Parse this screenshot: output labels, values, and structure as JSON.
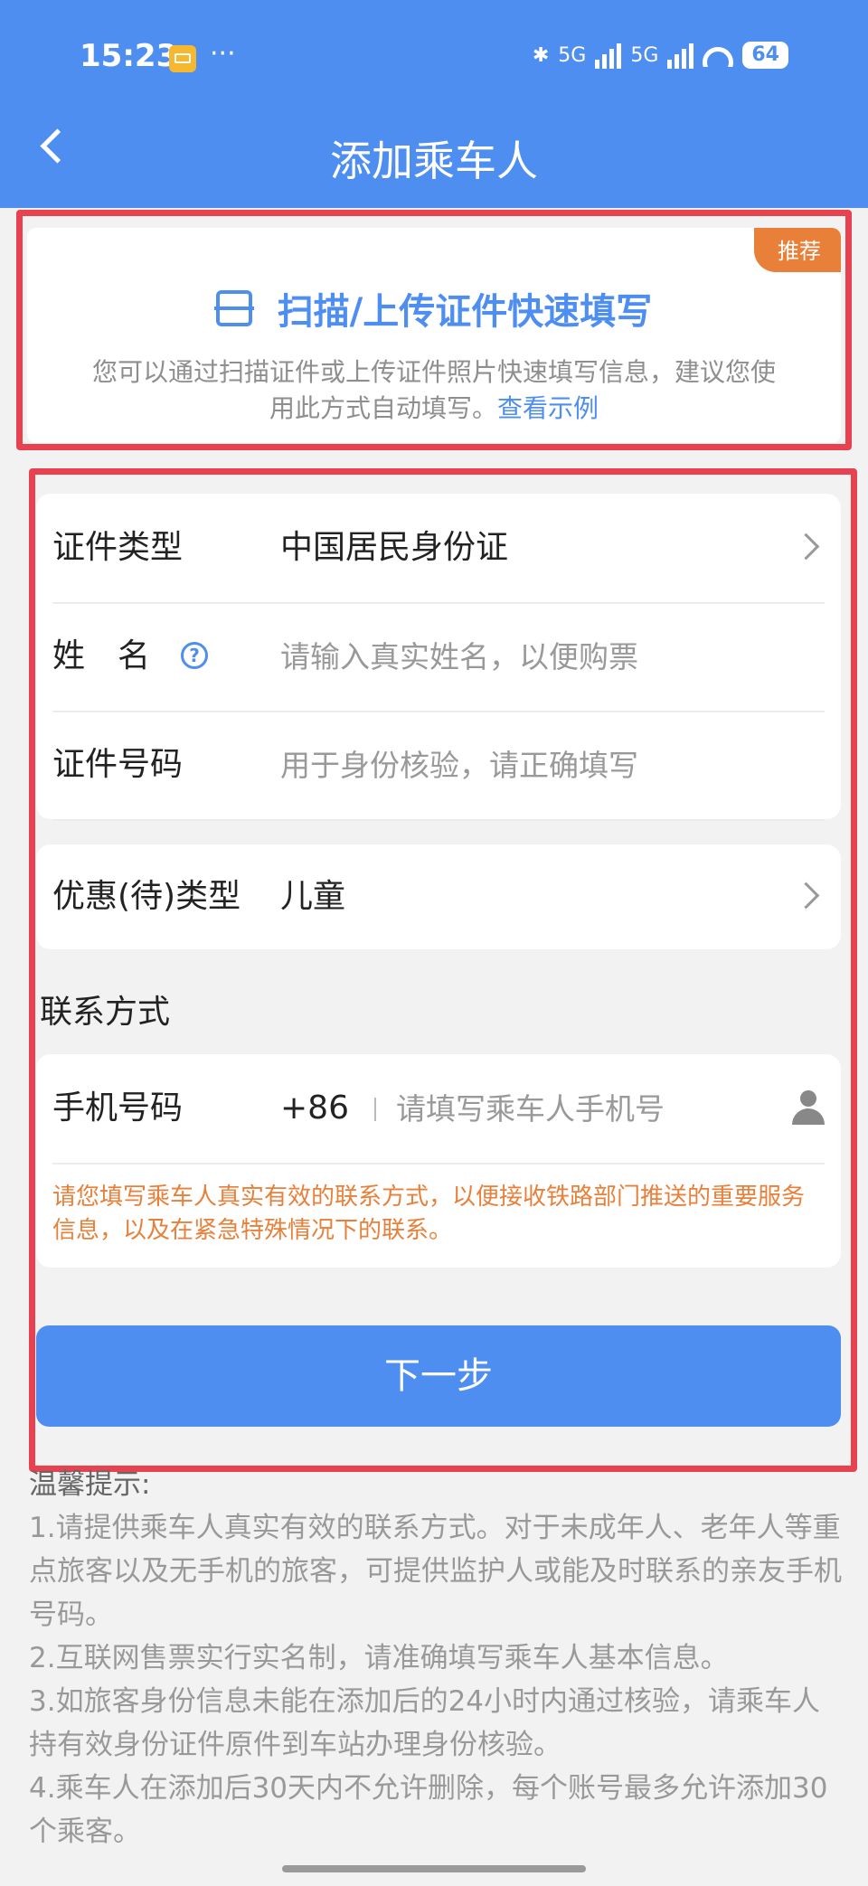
{
  "status_bar": {
    "time": "15:23",
    "dots": "···",
    "net1": "5G",
    "net2": "5G",
    "battery": "64"
  },
  "header": {
    "title": "添加乘车人"
  },
  "scan": {
    "badge": "推荐",
    "title": "扫描/上传证件快速填写",
    "desc": "您可以通过扫描证件或上传证件照片快速填写信息，建议您使用此方式自动填写。",
    "link": "查看示例"
  },
  "form": {
    "id_type": {
      "label": "证件类型",
      "value": "中国居民身份证"
    },
    "name": {
      "label": "姓　名",
      "placeholder": "请输入真实姓名，以便购票"
    },
    "id_number": {
      "label": "证件号码",
      "placeholder": "用于身份核验，请正确填写"
    },
    "discount": {
      "label": "优惠(待)类型",
      "value": "儿童"
    }
  },
  "contact": {
    "section_title": "联系方式",
    "phone_label": "手机号码",
    "country_code": "+86",
    "phone_placeholder": "请填写乘车人手机号",
    "notice": "请您填写乘车人真实有效的联系方式，以便接收铁路部门推送的重要服务信息，以及在紧急特殊情况下的联系。"
  },
  "next_button": "下一步",
  "tips": {
    "title": "温馨提示:",
    "items": [
      "1.请提供乘车人真实有效的联系方式。对于未成年人、老年人等重点旅客以及无手机的旅客，可提供监护人或能及时联系的亲友手机号码。",
      "2.互联网售票实行实名制，请准确填写乘车人基本信息。",
      "3.如旅客身份信息未能在添加后的24小时内通过核验，请乘车人持有效身份证件原件到车站办理身份核验。",
      "4.乘车人在添加后30天内不允许删除，每个账号最多允许添加30个乘客。"
    ]
  }
}
